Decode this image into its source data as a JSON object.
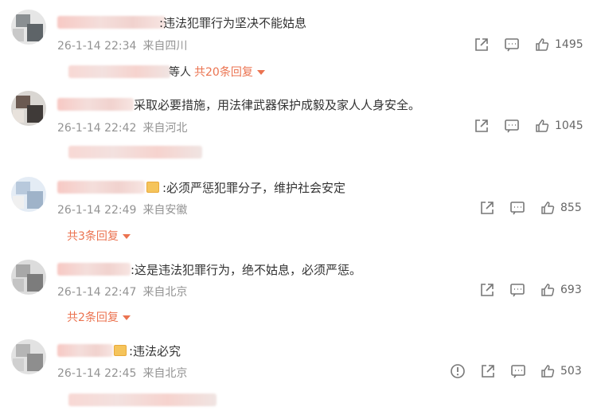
{
  "comments": [
    {
      "text": ":违法犯罪行为坚决不能姑息",
      "time": "26-1-14 22:34",
      "location": "来自四川",
      "likes": "1495",
      "reply_prefix": "等人",
      "reply_count": "共20条回复",
      "has_badge": false
    },
    {
      "text": "采取必要措施，用法律武器保护成毅及家人人身安全。",
      "time": "26-1-14 22:42",
      "location": "来自河北",
      "likes": "1045",
      "reply_prefix": "",
      "reply_count": "",
      "has_badge": false
    },
    {
      "text": ":必须严惩犯罪分子，维护社会安定",
      "time": "26-1-14 22:49",
      "location": "来自安徽",
      "likes": "855",
      "reply_prefix": "",
      "reply_count": "共3条回复",
      "has_badge": true
    },
    {
      "text": ":这是违法犯罪行为，绝不姑息，必须严惩。",
      "time": "26-1-14 22:47",
      "location": "来自北京",
      "likes": "693",
      "reply_prefix": "",
      "reply_count": "共2条回复",
      "has_badge": false
    },
    {
      "text": ":违法必究",
      "time": "26-1-14 22:45",
      "location": "来自北京",
      "likes": "503",
      "reply_prefix": "",
      "reply_count": "",
      "has_badge": true
    }
  ],
  "icons": {
    "share": "share-icon",
    "comment": "comment-icon",
    "like": "like-icon",
    "report": "report-icon"
  },
  "colors": {
    "reply_accent": "#eb7350",
    "meta_gray": "#939393",
    "text_dark": "#333333"
  }
}
